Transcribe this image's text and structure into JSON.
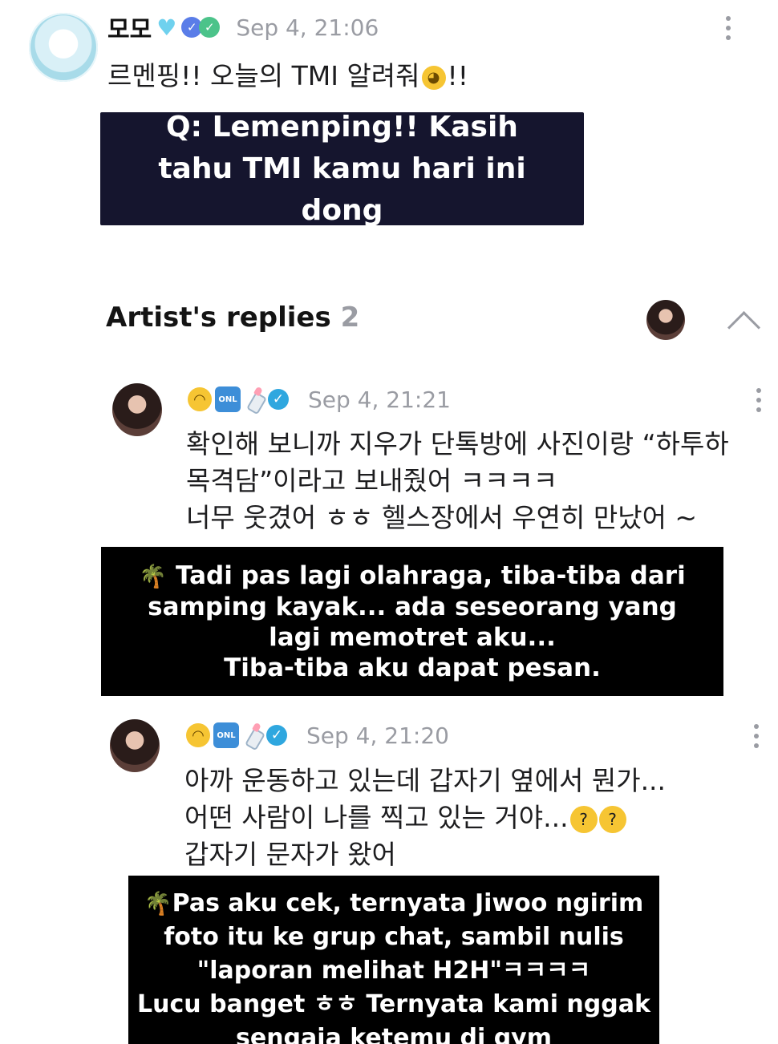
{
  "post": {
    "author_name": "모모",
    "heart_icon": "light-blue-heart-icon",
    "timestamp": "Sep 4, 21:06",
    "text": "르멘핑!! 오늘의 TMI 알려줘",
    "text_suffix": "!!",
    "translation": "Q: Lemenping!! Kasih tahu TMI kamu hari ini dong"
  },
  "replies": {
    "title": "Artist's replies",
    "count": "2"
  },
  "reply1": {
    "timestamp": "Sep 4, 21:21",
    "line1": "확인해 보니까 지우가 단톡방에 사진이랑 “하투하",
    "line2": "목격담”이라고 보내줬어 ㅋㅋㅋㅋ",
    "line3": "너무 웃겼어 ㅎㅎ 헬스장에서 우연히 만났어 ~",
    "translation_line1": "Tadi pas lagi olahraga, tiba-tiba dari",
    "translation_line2": "samping kayak... ada seseorang yang",
    "translation_line3": "lagi memotret aku...",
    "translation_line4": "Tiba-tiba aku dapat pesan."
  },
  "reply2": {
    "timestamp": "Sep 4, 21:20",
    "line1": "아까 운동하고 있는데 갑자기 옆에서 뭔가...",
    "line2": "어떤 사람이 나를 찍고 있는 거야...",
    "line3": "갑자기 문자가 왔어",
    "translation_line1": "Pas aku cek, ternyata Jiwoo ngirim",
    "translation_line2": "foto itu ke grup chat, sambil nulis",
    "translation_line3": "\"laporan melihat H2H\"ㅋㅋㅋㅋ",
    "translation_line4": "Lucu banget ㅎㅎ Ternyata kami nggak",
    "translation_line5": "sengaja ketemu di gym"
  },
  "icons": {
    "onl_badge": "ONL",
    "palm": "🌴"
  },
  "colors": {
    "caption_bg": "#000000",
    "question_bg": "#15152e",
    "verified": "#2fa7df",
    "timestamp": "#9a9ca3"
  }
}
